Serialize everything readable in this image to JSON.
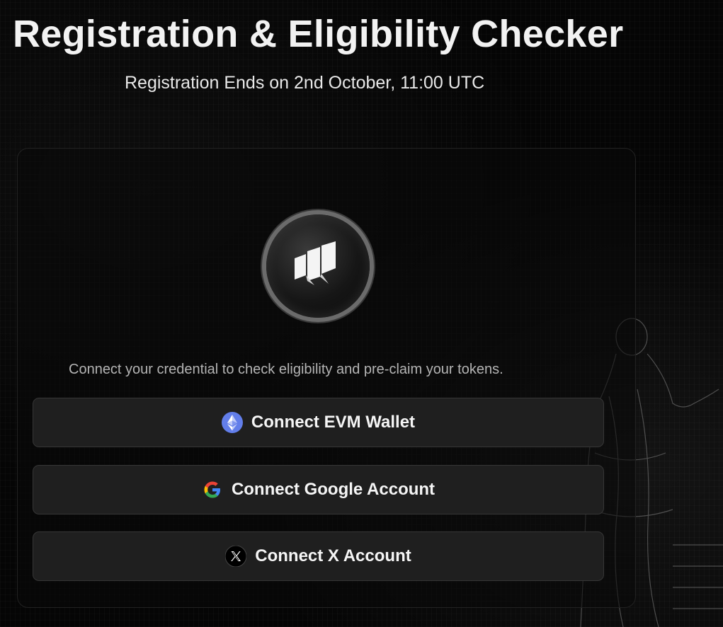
{
  "header": {
    "title": "Registration & Eligibility Checker",
    "subtitle": "Registration Ends on 2nd October, 11:00 UTC"
  },
  "card": {
    "logo_icon": "brand-logo-icon",
    "caption": "Connect your credential to check eligibility and pre-claim your tokens.",
    "buttons": [
      {
        "label": "Connect EVM Wallet",
        "icon": "ethereum-icon"
      },
      {
        "label": "Connect Google Account",
        "icon": "google-icon"
      },
      {
        "label": "Connect X Account",
        "icon": "x-icon"
      }
    ]
  },
  "colors": {
    "background": "#050505",
    "button_bg": "#1f1f1f",
    "ethereum": "#627eea",
    "text": "#f2f2f2"
  }
}
